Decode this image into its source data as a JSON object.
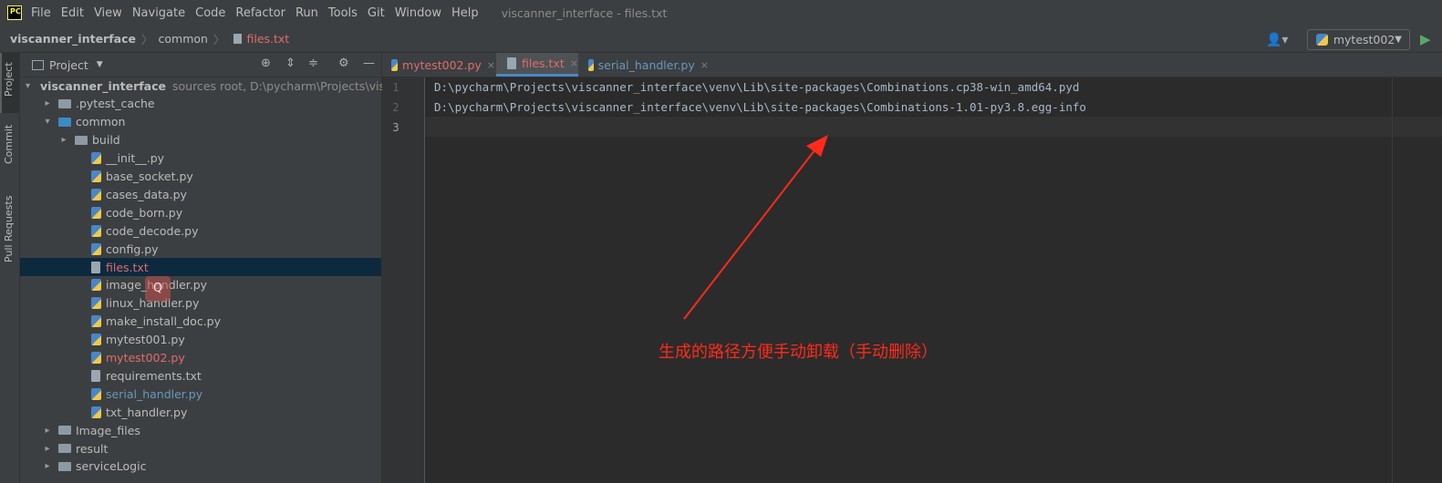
{
  "app": {
    "logo": "PC",
    "window_title": "viscanner_interface - files.txt"
  },
  "menu": [
    "File",
    "Edit",
    "View",
    "Navigate",
    "Code",
    "Refactor",
    "Run",
    "Tools",
    "Git",
    "Window",
    "Help"
  ],
  "breadcrumb": {
    "project": "viscanner_interface",
    "folder": "common",
    "file": "files.txt"
  },
  "run_config": {
    "label": "mytest002",
    "user_icon": "user-icon",
    "run_icon": "play-icon"
  },
  "left_strip": {
    "project": "Project",
    "commit": "Commit",
    "pull_requests": "Pull Requests"
  },
  "panel": {
    "title": "Project",
    "tree": [
      {
        "label": "viscanner_interface",
        "extra": "sources root,  D:\\pycharm\\Projects\\visca",
        "type": "folder-blue",
        "indent": 0,
        "arrow": "▾",
        "style": "bold"
      },
      {
        "label": ".pytest_cache",
        "type": "folder-gray",
        "indent": 1,
        "arrow": "▸"
      },
      {
        "label": "common",
        "type": "folder-blue",
        "indent": 1,
        "arrow": "▾"
      },
      {
        "label": "build",
        "type": "folder-gray",
        "indent": 2,
        "arrow": "▸"
      },
      {
        "label": "__init__.py",
        "type": "py",
        "indent": 3
      },
      {
        "label": "base_socket.py",
        "type": "py",
        "indent": 3
      },
      {
        "label": "cases_data.py",
        "type": "py",
        "indent": 3
      },
      {
        "label": "code_born.py",
        "type": "py",
        "indent": 3
      },
      {
        "label": "code_decode.py",
        "type": "py",
        "indent": 3
      },
      {
        "label": "config.py",
        "type": "py",
        "indent": 3
      },
      {
        "label": "files.txt",
        "type": "txt",
        "indent": 3,
        "style": "red",
        "selected": true
      },
      {
        "label": "image_handler.py",
        "type": "py",
        "indent": 3
      },
      {
        "label": "linux_handler.py",
        "type": "py",
        "indent": 3
      },
      {
        "label": "make_install_doc.py",
        "type": "py",
        "indent": 3
      },
      {
        "label": "mytest001.py",
        "type": "py",
        "indent": 3
      },
      {
        "label": "mytest002.py",
        "type": "py",
        "indent": 3,
        "style": "red"
      },
      {
        "label": "requirements.txt",
        "type": "txt",
        "indent": 3
      },
      {
        "label": "serial_handler.py",
        "type": "py",
        "indent": 3,
        "style": "blue"
      },
      {
        "label": "txt_handler.py",
        "type": "py",
        "indent": 3
      },
      {
        "label": "Image_files",
        "type": "folder-gray",
        "indent": 1,
        "arrow": "▸"
      },
      {
        "label": "result",
        "type": "folder-gray",
        "indent": 1,
        "arrow": "▸"
      },
      {
        "label": "serviceLogic",
        "type": "folder-gray",
        "indent": 1,
        "arrow": "▸"
      }
    ]
  },
  "tabs": [
    {
      "label": "mytest002.py",
      "color": "#e06c6c",
      "close": "×"
    },
    {
      "label": "files.txt",
      "color": "#e06c6c",
      "close": "×",
      "active": true
    },
    {
      "label": "serial_handler.py",
      "color": "#6897bb",
      "close": "×"
    }
  ],
  "editor": {
    "line_numbers": [
      "1",
      "2",
      "3"
    ],
    "lines": [
      "D:\\pycharm\\Projects\\viscanner_interface\\venv\\Lib\\site-packages\\Combinations.cp38-win_amd64.pyd",
      "D:\\pycharm\\Projects\\viscanner_interface\\venv\\Lib\\site-packages\\Combinations-1.01-py3.8.egg-info",
      ""
    ]
  },
  "annotation": {
    "text": "生成的路径方便手动卸载（手动删除）",
    "color": "#ff2a1a"
  }
}
